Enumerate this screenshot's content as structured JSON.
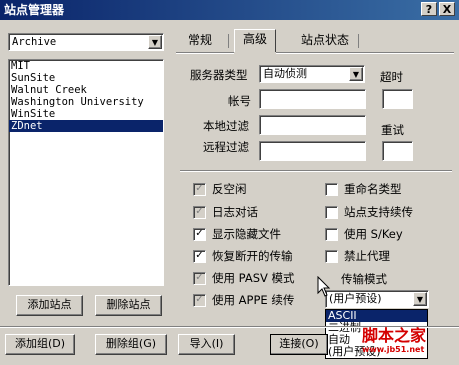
{
  "window": {
    "title": "站点管理器",
    "help_btn": "?",
    "close_btn": "X"
  },
  "site_select": {
    "value": "Archive"
  },
  "site_list": {
    "items": [
      "MIT",
      "SunSite",
      "Walnut Creek",
      "Washington University",
      "WinSite",
      "ZDnet"
    ],
    "selected": "ZDnet"
  },
  "tabs": [
    "常规",
    "高级",
    "站点状态"
  ],
  "active_tab": "高级",
  "form": {
    "server_type_label": "服务器类型",
    "server_type_value": "自动侦测",
    "timeout_label": "超时",
    "account_label": "帐号",
    "local_filter_label": "本地过滤",
    "retry_label": "重试",
    "remote_filter_label": "远程过滤"
  },
  "options_left": [
    {
      "label": "反空闲",
      "checked": true
    },
    {
      "label": "日志对话",
      "checked": true
    },
    {
      "label": "显示隐藏文件",
      "checked": true
    },
    {
      "label": "恢复断开的传输",
      "checked": true
    },
    {
      "label": "使用 PASV 模式",
      "checked": true
    },
    {
      "label": "使用 APPE 续传",
      "checked": true
    }
  ],
  "options_right": [
    {
      "label": "重命名类型",
      "checked": false
    },
    {
      "label": "站点支持续传",
      "checked": false
    },
    {
      "label": "使用 S/Key",
      "checked": false
    },
    {
      "label": "禁止代理",
      "checked": false
    }
  ],
  "transfer_mode": {
    "label": "传输模式",
    "value": "(用户预设)",
    "options": [
      "ASCII",
      "二进制",
      "自动",
      "(用户预设)"
    ],
    "highlighted": "ASCII"
  },
  "buttons": {
    "add_site": "添加站点",
    "delete_site": "删除站点",
    "add_group": "添加组(D)",
    "delete_group": "删除组(G)",
    "import": "导入(I)",
    "connect": "连接(O)"
  },
  "watermark": {
    "title": "脚本之家",
    "url": "www.jb51.net"
  }
}
